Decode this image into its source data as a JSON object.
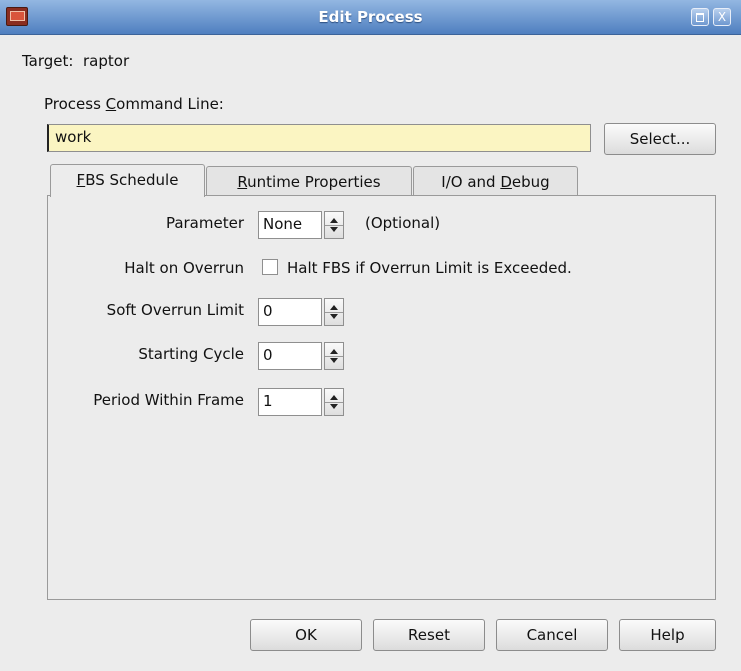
{
  "window": {
    "title": "Edit Process",
    "close_glyph": "X"
  },
  "target": {
    "label": "Target:",
    "value": "raptor"
  },
  "command": {
    "label_pre": "Process ",
    "label_mnemonic": "C",
    "label_post": "ommand Line:",
    "value": "work",
    "select_label": "Select..."
  },
  "tabs": [
    {
      "mnemonic": "F",
      "rest": "BS Schedule",
      "pre": ""
    },
    {
      "mnemonic": "R",
      "rest": "untime Properties",
      "pre": ""
    },
    {
      "pre": "I/O and ",
      "mnemonic": "D",
      "rest": "ebug"
    }
  ],
  "schedule": {
    "parameter": {
      "label": "Parameter",
      "value": "None",
      "hint": "(Optional)"
    },
    "halt": {
      "label": "Halt on Overrun",
      "checkbox_label": "Halt FBS if Overrun Limit is Exceeded.",
      "checked": false
    },
    "soft_limit": {
      "label": "Soft Overrun Limit",
      "value": "0"
    },
    "starting_cycle": {
      "label": "Starting Cycle",
      "value": "0"
    },
    "period": {
      "label": "Period Within Frame",
      "value": "1"
    }
  },
  "buttons": {
    "ok": "OK",
    "reset": "Reset",
    "cancel": "Cancel",
    "help": "Help"
  },
  "colors": {
    "title_bar": "#4f7fc0",
    "input_highlight": "#fbf5c2"
  }
}
